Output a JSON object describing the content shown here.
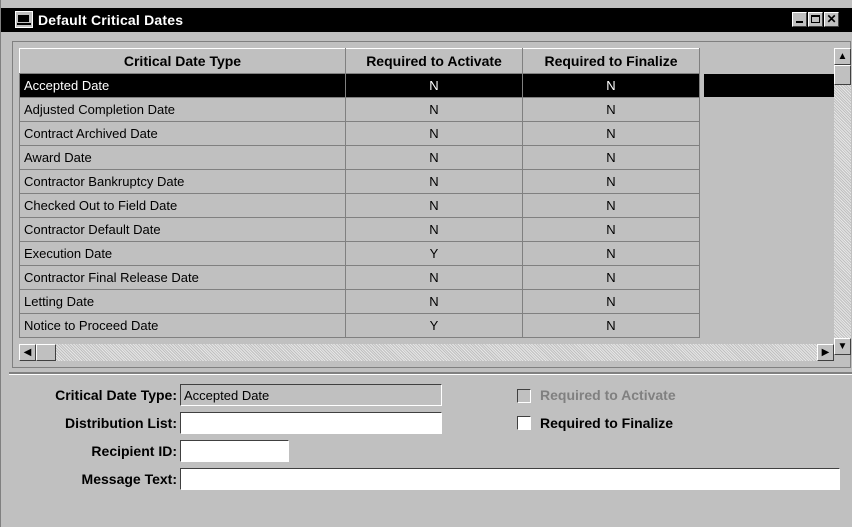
{
  "window": {
    "title": "Default Critical Dates"
  },
  "grid": {
    "columns": [
      "Critical Date Type",
      "Required to Activate",
      "Required to Finalize"
    ],
    "rows": [
      {
        "type": "Accepted Date",
        "activate": "N",
        "finalize": "N"
      },
      {
        "type": "Adjusted Completion Date",
        "activate": "N",
        "finalize": "N"
      },
      {
        "type": "Contract Archived Date",
        "activate": "N",
        "finalize": "N"
      },
      {
        "type": "Award Date",
        "activate": "N",
        "finalize": "N"
      },
      {
        "type": "Contractor Bankruptcy Date",
        "activate": "N",
        "finalize": "N"
      },
      {
        "type": "Checked Out to Field Date",
        "activate": "N",
        "finalize": "N"
      },
      {
        "type": "Contractor Default Date",
        "activate": "N",
        "finalize": "N"
      },
      {
        "type": "Execution Date",
        "activate": "Y",
        "finalize": "N"
      },
      {
        "type": "Contractor Final Release Date",
        "activate": "N",
        "finalize": "N"
      },
      {
        "type": "Letting Date",
        "activate": "N",
        "finalize": "N"
      },
      {
        "type": "Notice to Proceed Date",
        "activate": "Y",
        "finalize": "N"
      }
    ],
    "selected_index": 0
  },
  "form": {
    "critical_date_type_label": "Critical Date Type:",
    "critical_date_type_value": "Accepted Date",
    "distribution_list_label": "Distribution List:",
    "distribution_list_value": "",
    "recipient_id_label": "Recipient ID:",
    "recipient_id_value": "",
    "message_text_label": "Message Text:",
    "message_text_value": "",
    "required_to_activate_label": "Required to Activate",
    "required_to_activate_checked": false,
    "required_to_activate_enabled": false,
    "required_to_finalize_label": "Required to Finalize",
    "required_to_finalize_checked": false
  },
  "colors": {
    "selection": "#000000",
    "face": "#c0c0c0"
  }
}
